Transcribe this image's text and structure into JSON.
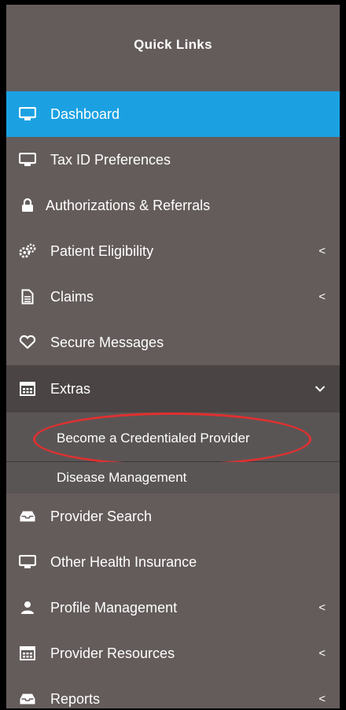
{
  "panel": {
    "title": "Quick Links",
    "accent_color": "#1ba1e2",
    "highlight_color": "#e03030"
  },
  "menu": [
    {
      "label": "Dashboard",
      "icon": "monitor-icon",
      "active": true
    },
    {
      "label": "Tax ID Preferences",
      "icon": "monitor-icon"
    },
    {
      "label": "Authorizations & Referrals",
      "icon": "lock-icon"
    },
    {
      "label": "Patient Eligibility",
      "icon": "gears-icon",
      "chevron": "<"
    },
    {
      "label": "Claims",
      "icon": "document-icon",
      "chevron": "<"
    },
    {
      "label": "Secure Messages",
      "icon": "heart-icon"
    },
    {
      "label": "Extras",
      "icon": "calculator-icon",
      "chevron": "⌄",
      "expanded": true,
      "children": [
        {
          "label": "Become a Credentialed Provider",
          "circled": true
        },
        {
          "label": "Disease Management"
        }
      ]
    },
    {
      "label": "Provider Search",
      "icon": "inbox-icon"
    },
    {
      "label": "Other Health Insurance",
      "icon": "monitor-icon"
    },
    {
      "label": "Profile Management",
      "icon": "user-icon",
      "chevron": "<"
    },
    {
      "label": "Provider Resources",
      "icon": "calculator-icon",
      "chevron": "<"
    },
    {
      "label": "Reports",
      "icon": "inbox-icon",
      "chevron": "<"
    }
  ]
}
